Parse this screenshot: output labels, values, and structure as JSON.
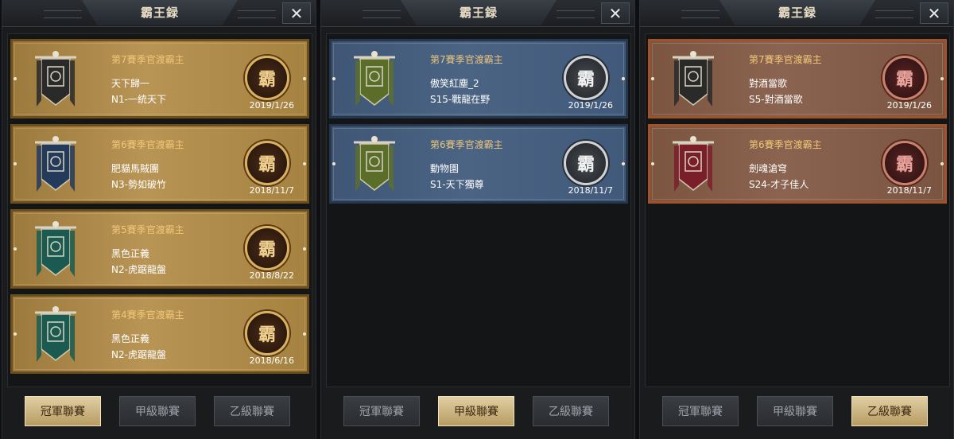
{
  "panels": [
    {
      "title": "霸王録",
      "theme": "gold",
      "active_tab": 0,
      "cards": [
        {
          "season": "第7賽季官渡霸主",
          "guild": "天下歸一",
          "server": "N1-一統天下",
          "date": "2019/1/26",
          "badge": "霸",
          "banner_color": "#2a2a2a"
        },
        {
          "season": "第6賽季官渡霸主",
          "guild": "肥貓馬賊團",
          "server": "N3-勢如破竹",
          "date": "2018/11/7",
          "badge": "霸",
          "banner_color": "#243a5a"
        },
        {
          "season": "第5賽季官渡霸主",
          "guild": "黑色正義",
          "server": "N2-虎踞龍盤",
          "date": "2018/8/22",
          "badge": "霸",
          "banner_color": "#1a5a50"
        },
        {
          "season": "第4賽季官渡霸主",
          "guild": "黑色正義",
          "server": "N2-虎踞龍盤",
          "date": "2018/6/16",
          "badge": "霸",
          "banner_color": "#1a5a50"
        }
      ]
    },
    {
      "title": "霸王録",
      "theme": "blue",
      "active_tab": 1,
      "cards": [
        {
          "season": "第7賽季官渡霸主",
          "guild": "傲笑紅塵_2",
          "server": "S15-戰龍在野",
          "date": "2019/1/26",
          "badge": "霸",
          "banner_color": "#5a6e2a"
        },
        {
          "season": "第6賽季官渡霸主",
          "guild": "動物園",
          "server": "S1-天下獨尊",
          "date": "2018/11/7",
          "badge": "霸",
          "banner_color": "#5a6e2a"
        }
      ]
    },
    {
      "title": "霸王録",
      "theme": "red",
      "active_tab": 2,
      "cards": [
        {
          "season": "第7賽季官渡霸主",
          "guild": "對酒當歌",
          "server": "S5-對酒當歌",
          "date": "2019/1/26",
          "badge": "霸",
          "banner_color": "#2a2a2a"
        },
        {
          "season": "第6賽季官渡霸主",
          "guild": "劍魂滄穹",
          "server": "S24-才子佳人",
          "date": "2018/11/7",
          "badge": "霸",
          "banner_color": "#7a1e2a"
        }
      ]
    }
  ],
  "tabs": [
    "冠軍聯賽",
    "甲級聯賽",
    "乙級聯賽"
  ],
  "icons": {
    "close": "close-icon",
    "badge": "ba-emblem-icon",
    "banner": "guild-banner-icon"
  },
  "colors": {
    "gold_card": "#b89455",
    "blue_card": "#4b6484",
    "red_card": "#8a6450",
    "season_text": "#f1c777",
    "active_tab": "#d6c08f"
  }
}
